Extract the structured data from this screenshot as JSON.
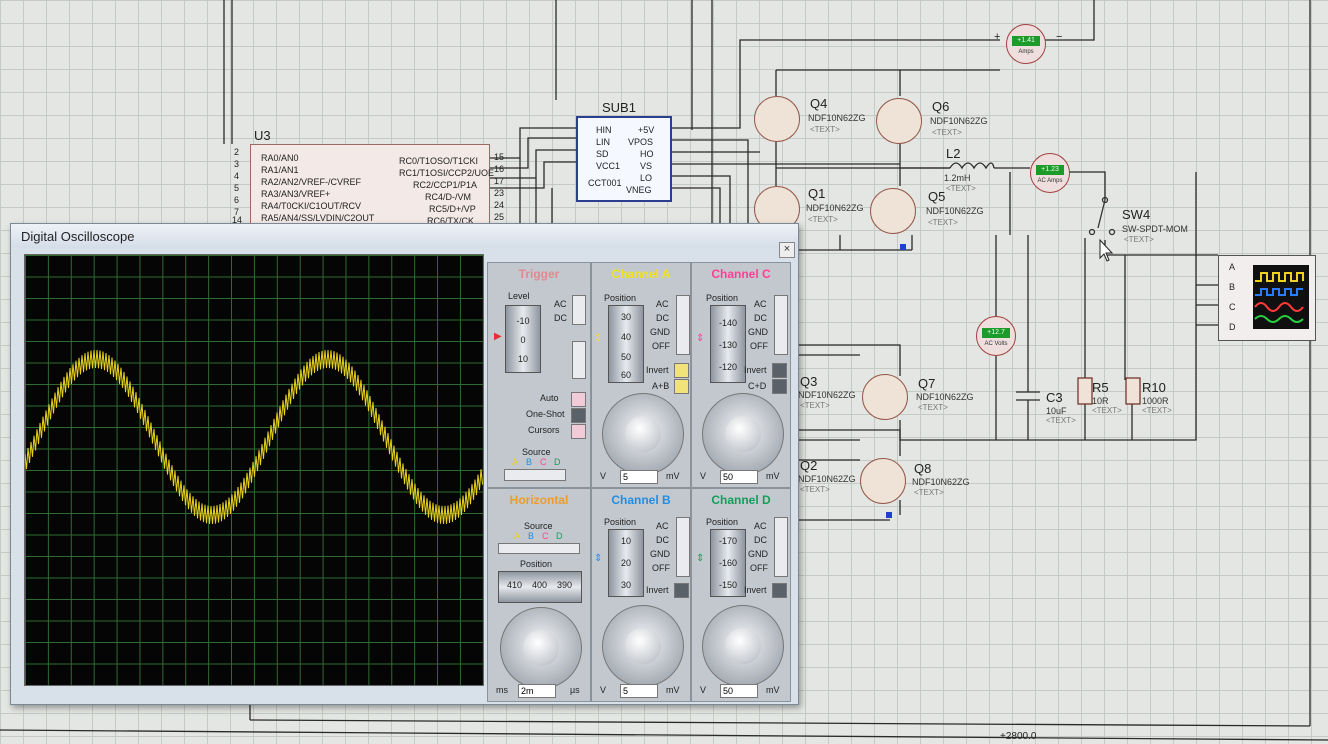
{
  "schematic": {
    "mcu": {
      "ref": "U3",
      "left_pins": [
        "RA0/AN0",
        "RA1/AN1",
        "RA2/AN2/VREF-/CVREF",
        "RA3/AN3/VREF+",
        "RA4/T0CKI/C1OUT/RCV",
        "RA5/AN4/SS/LVDIN/C2OUT"
      ],
      "right_pins": [
        "RC0/T1OSO/T1CKI",
        "RC1/T1OSI/CCP2/UOE",
        "RC2/CCP1/P1A",
        "RC4/D-/VM",
        "RC5/D+/VP",
        "RC6/TX/CK"
      ],
      "left_pin_nums": [
        "2",
        "3",
        "4",
        "5",
        "6",
        "7",
        "14"
      ],
      "right_pin_nums": [
        "15",
        "16",
        "17",
        "23",
        "24",
        "25",
        "26"
      ]
    },
    "driver": {
      "ref": "SUB1",
      "left_pins": [
        "HIN",
        "LIN",
        "SD",
        "VCC1"
      ],
      "right_pins": [
        "+5V",
        "VPOS",
        "HO",
        "VS",
        "LO",
        "VNEG"
      ],
      "part": "CCT001"
    },
    "mosfets": [
      {
        "ref": "Q4",
        "part": "NDF10N62ZG",
        "text": "<TEXT>"
      },
      {
        "ref": "Q6",
        "part": "NDF10N62ZG",
        "text": "<TEXT>"
      },
      {
        "ref": "Q1",
        "part": "NDF10N62ZG",
        "text": "<TEXT>"
      },
      {
        "ref": "Q5",
        "part": "NDF10N62ZG",
        "text": "<TEXT>"
      },
      {
        "ref": "Q3",
        "part": "NDF10N62ZG",
        "text": "<TEXT>"
      },
      {
        "ref": "Q7",
        "part": "NDF10N62ZG",
        "text": "<TEXT>"
      },
      {
        "ref": "Q2",
        "part": "NDF10N62ZG",
        "text": "<TEXT>"
      },
      {
        "ref": "Q8",
        "part": "NDF10N62ZG",
        "text": "<TEXT>"
      }
    ],
    "inductor": {
      "ref": "L2",
      "value": "1.2mH",
      "text": "<TEXT>"
    },
    "capacitor": {
      "ref": "C3",
      "value": "10uF",
      "text": "<TEXT>"
    },
    "resistors": [
      {
        "ref": "R5",
        "value": "10R",
        "text": "<TEXT>"
      },
      {
        "ref": "R10",
        "value": "1000R",
        "text": "<TEXT>"
      }
    ],
    "switch": {
      "ref": "SW4",
      "part": "SW-SPDT-MOM",
      "text": "<TEXT>"
    },
    "meters": [
      {
        "reading": "+1.41",
        "label": "Amps"
      },
      {
        "reading": "+1.23",
        "label": "AC Amps"
      },
      {
        "reading": "+12.7",
        "label": "AC Volts"
      }
    ],
    "scope_inputs": [
      "A",
      "B",
      "C",
      "D"
    ],
    "coord_readout": "+2800.0",
    "plus_sign": "+",
    "minus_sign": "−"
  },
  "oscilloscope": {
    "title": "Digital Oscilloscope",
    "close_label": "×",
    "trace_color": "#e8d21c",
    "trigger": {
      "title": "Trigger",
      "level_label": "Level",
      "level_scale": [
        "-10",
        "0",
        "10"
      ],
      "coupling": [
        "AC",
        "DC"
      ],
      "buttons": [
        "Auto",
        "One-Shot",
        "Cursors"
      ],
      "source_label": "Source",
      "sources": [
        "A",
        "B",
        "C",
        "D"
      ]
    },
    "horizontal": {
      "title": "Horizontal",
      "source_label": "Source",
      "sources": [
        "A",
        "B",
        "C",
        "D"
      ],
      "position_label": "Position",
      "position_scale": [
        "410",
        "400",
        "390"
      ],
      "knob_ticks": [
        "0.5",
        "0.2",
        "0.1",
        "50",
        "20",
        "10",
        "5",
        "2",
        "1",
        "0.5",
        "0.2",
        "0.1",
        "200",
        "100",
        "50",
        "20",
        "10",
        "5",
        "2",
        "1"
      ],
      "time_value": "2m",
      "unit_left": "ms",
      "unit_right": "µs"
    },
    "channels": [
      {
        "id": "A",
        "title": "Channel A",
        "color": "#f2e21a",
        "position_label": "Position",
        "scale": [
          "30",
          "40",
          "50",
          "60"
        ],
        "coupling": [
          "AC",
          "DC",
          "GND",
          "OFF"
        ],
        "invert_label": "Invert",
        "combine_label": "A+B",
        "volt_value": "5",
        "unit_left": "V",
        "unit_right": "mV",
        "knob_ticks": [
          "0.5",
          "1",
          "2",
          "5",
          "10",
          "20",
          "50",
          "100",
          "200"
        ]
      },
      {
        "id": "C",
        "title": "Channel C",
        "color": "#ff3f93",
        "position_label": "Position",
        "scale": [
          "-140",
          "-130",
          "-120"
        ],
        "coupling": [
          "AC",
          "DC",
          "GND",
          "OFF"
        ],
        "invert_label": "Invert",
        "combine_label": "C+D",
        "volt_value": "50",
        "unit_left": "V",
        "unit_right": "mV",
        "knob_ticks": [
          "0.5",
          "1",
          "2",
          "5",
          "10",
          "20",
          "50",
          "100",
          "200"
        ]
      },
      {
        "id": "B",
        "title": "Channel B",
        "color": "#1e8fe6",
        "position_label": "Position",
        "scale": [
          "10",
          "20",
          "30"
        ],
        "coupling": [
          "AC",
          "DC",
          "GND",
          "OFF"
        ],
        "invert_label": "Invert",
        "volt_value": "5",
        "unit_left": "V",
        "unit_right": "mV",
        "knob_ticks": [
          "0.5",
          "1",
          "2",
          "5",
          "10",
          "20",
          "50",
          "100",
          "200"
        ]
      },
      {
        "id": "D",
        "title": "Channel D",
        "color": "#11a05a",
        "position_label": "Position",
        "scale": [
          "-170",
          "-160",
          "-150"
        ],
        "coupling": [
          "AC",
          "DC",
          "GND",
          "OFF"
        ],
        "invert_label": "Invert",
        "volt_value": "50",
        "unit_left": "V",
        "unit_right": "mV",
        "knob_ticks": [
          "0.5",
          "1",
          "2",
          "5",
          "10",
          "20",
          "50",
          "100",
          "200"
        ]
      }
    ]
  }
}
